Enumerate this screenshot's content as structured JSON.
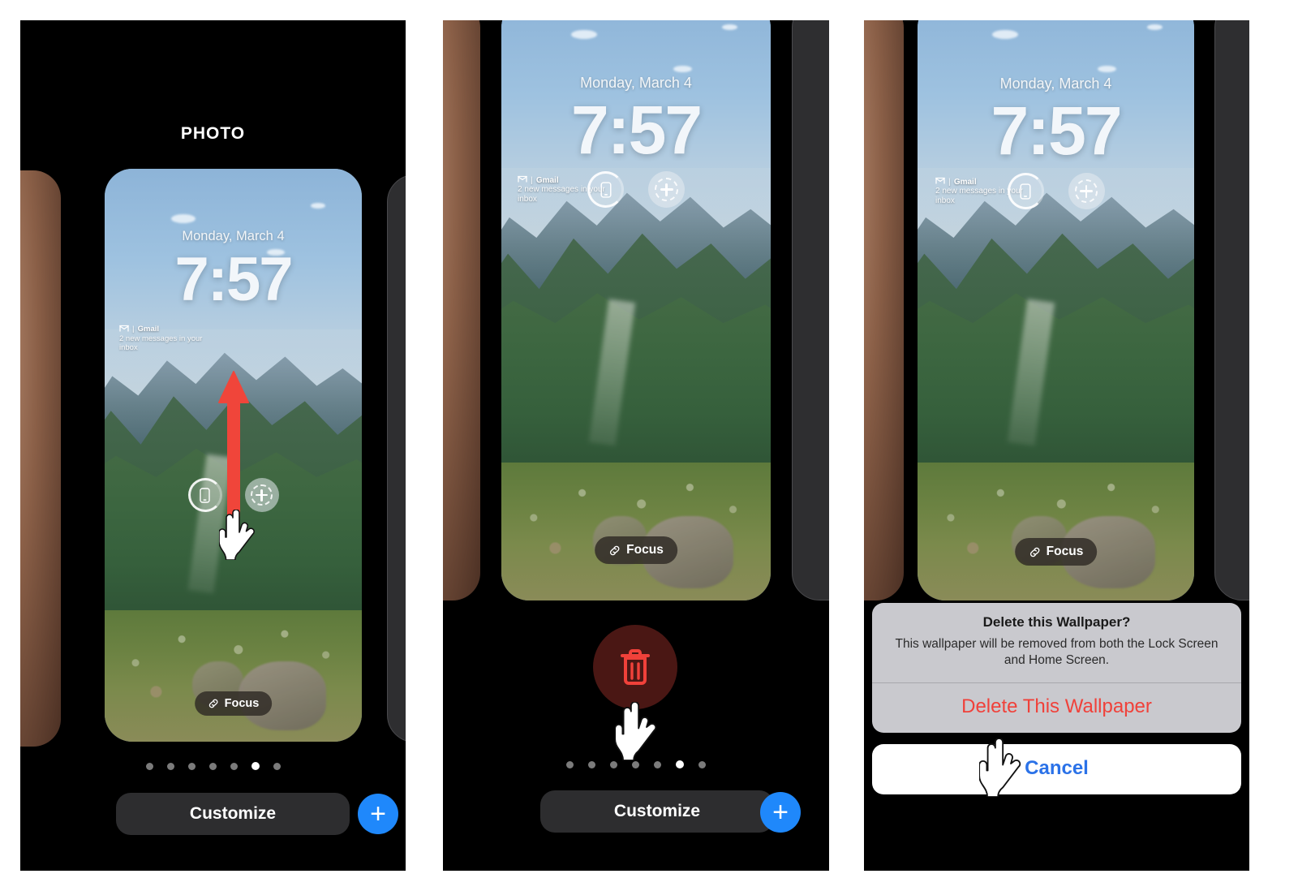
{
  "panels": [
    {
      "id": "photo-picker-swipe-up",
      "title": "PHOTO",
      "lock_screen": {
        "date": "Monday, March 4",
        "time": "7:57",
        "widget": {
          "app_icon": "gmail-icon",
          "app_name": "Gmail",
          "body": "2 new messages in your inbox"
        },
        "controls": [
          {
            "name": "flashlight-control",
            "icon": "phone-icon"
          },
          {
            "name": "add-control",
            "icon": "plus-dashed-circle-icon"
          }
        ],
        "focus_pill": {
          "icon": "link-icon",
          "label": "Focus"
        }
      },
      "gesture": {
        "type": "swipe-up-arrow",
        "color": "#F0453A",
        "cursor": "hand-pointer"
      },
      "shelf": {
        "page_dots": {
          "count": 7,
          "active_index": 5
        },
        "customize_label": "Customize",
        "add_label": "+"
      }
    },
    {
      "id": "wallpaper-delete-trash",
      "title": "",
      "lock_screen": {
        "date": "Monday, March 4",
        "time": "7:57",
        "widget": {
          "app_icon": "gmail-icon",
          "app_name": "Gmail",
          "body": "2 new messages in your inbox"
        },
        "controls": [
          {
            "name": "flashlight-control",
            "icon": "phone-icon"
          },
          {
            "name": "add-control",
            "icon": "plus-dashed-circle-icon"
          }
        ],
        "focus_pill": {
          "icon": "link-icon",
          "label": "Focus"
        }
      },
      "trash": {
        "name": "delete-wallpaper-button",
        "icon": "trash-icon",
        "cursor": "hand-pointer"
      },
      "shelf": {
        "page_dots": {
          "count": 7,
          "active_index": 5
        },
        "customize_label": "Customize",
        "add_label": "+"
      }
    },
    {
      "id": "wallpaper-delete-confirm",
      "title": "",
      "lock_screen": {
        "date": "Monday, March 4",
        "time": "7:57",
        "widget": {
          "app_icon": "gmail-icon",
          "app_name": "Gmail",
          "body": "2 new messages in your inbox"
        },
        "controls": [
          {
            "name": "flashlight-control",
            "icon": "phone-icon"
          },
          {
            "name": "add-control",
            "icon": "plus-dashed-circle-icon"
          }
        ],
        "focus_pill": {
          "icon": "link-icon",
          "label": "Focus"
        }
      },
      "alert": {
        "title": "Delete this Wallpaper?",
        "message": "This wallpaper will be removed from both the Lock Screen and Home Screen.",
        "destructive_label": "Delete This Wallpaper",
        "cancel_label": "Cancel",
        "destructive_color": "#F0413A",
        "cancel_color": "#2B72E8",
        "cursor": "hand-pointer"
      }
    }
  ],
  "colors": {
    "accent_blue": "#1F88FB",
    "destructive_red": "#F0413A",
    "arrow_red": "#F0453A",
    "shelf_dark": "#2D2D2F",
    "alert_bg": "#C9C9CE"
  }
}
